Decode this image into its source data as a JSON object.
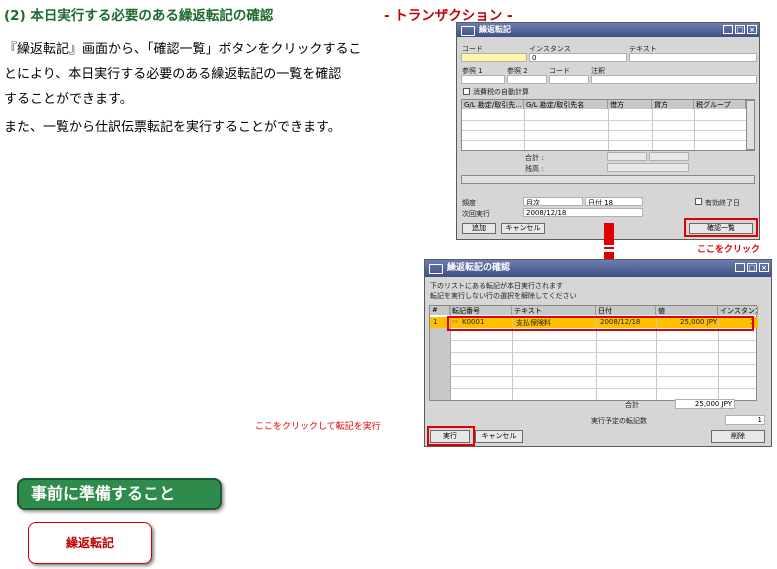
{
  "heading": {
    "title": "(2) 本日実行する必要のある繰返転記の確認",
    "subtitle": "- トランザクション -"
  },
  "description": {
    "lines": [
      "『繰返転記』画面から、「確認一覧」ボタンをクリックするこ",
      "とにより、本日実行する必要のある繰返転記の一覧を確認",
      "することができます。",
      "また、一覧から仕訳伝票転記を実行することができます。"
    ]
  },
  "window1": {
    "title": "繰返転記",
    "labels": {
      "code": "コード",
      "instance": "インスタンス",
      "text": "テキスト",
      "ref1": "参照 1",
      "ref2": "参照 2",
      "code2": "コード",
      "memo": "注釈",
      "auto_calc": "消費税の自動計算",
      "total": "合計 :",
      "balance": "残高 :",
      "frequency": "頻度",
      "next_exec": "次回実行",
      "valid_until": "有効終了日"
    },
    "instance_value": "0",
    "columns": [
      "G/L 勘定/取引先...",
      "G/L 勘定/取引先名",
      "借方",
      "貸方",
      "税グループ"
    ],
    "frequency_value": "月次",
    "day_value": "日付 18",
    "next_exec_value": "2008/12/18",
    "add_button": "追加",
    "cancel_button": "キャンセル",
    "confirm_list_button": "確認一覧"
  },
  "callout_click_here": "ここをクリック",
  "window2": {
    "title": "繰返転記の確認",
    "info_line1": "下のリストにある転記が本日実行されます",
    "info_line2": "転記を実行しない行の選択を解除してください",
    "columns": [
      "#",
      "転記番号",
      "テキスト",
      "日付",
      "値",
      "インスタンス"
    ],
    "rows": [
      {
        "num": "1",
        "posting_no": "K0001",
        "text": "支払保険料",
        "date": "2008/12/18",
        "value": "25,000 JPY",
        "instance": "1"
      }
    ],
    "total_label": "合計",
    "total_value": "25,000 JPY",
    "count_label": "実行予定の転記数",
    "count_value": "1",
    "execute_button": "実行",
    "cancel_button": "キャンセル",
    "delete_button": "削除"
  },
  "callout_execute": "ここをクリックして転記を実行",
  "prep": {
    "banner": "事前に準備すること",
    "tab": "繰返転記"
  }
}
